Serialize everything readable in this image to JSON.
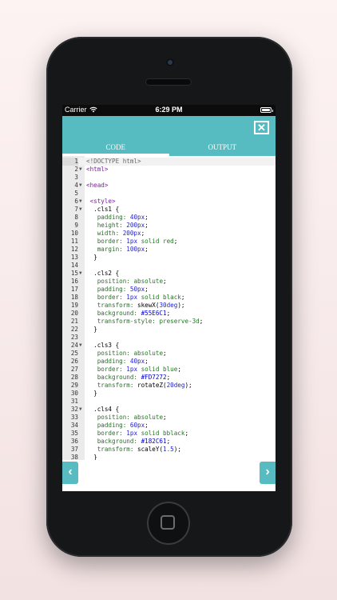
{
  "status_bar": {
    "carrier": "Carrier",
    "time": "6:29 PM"
  },
  "header": {
    "close_label": "✕"
  },
  "tabs": [
    {
      "label": "CODE"
    },
    {
      "label": "OUTPUT"
    }
  ],
  "nav": {
    "prev": "‹",
    "next": "›"
  },
  "colors": {
    "accent": "#56bcc1",
    "phone": "#161719"
  },
  "code_lines": [
    {
      "n": "1",
      "fold": "",
      "tokens": [
        [
          "doctype",
          "<!DOCTYPE html>"
        ]
      ]
    },
    {
      "n": "2",
      "fold": "▼",
      "tokens": [
        [
          "tag",
          "<html>"
        ]
      ]
    },
    {
      "n": "3",
      "fold": "",
      "tokens": []
    },
    {
      "n": "4",
      "fold": "▼",
      "tokens": [
        [
          "tag",
          "<head>"
        ]
      ]
    },
    {
      "n": "5",
      "fold": "",
      "tokens": []
    },
    {
      "n": "6",
      "fold": "▼",
      "tokens": [
        [
          "plain",
          " "
        ],
        [
          "tag",
          "<style>"
        ]
      ]
    },
    {
      "n": "7",
      "fold": "▼",
      "tokens": [
        [
          "plain",
          "  .cls1 {"
        ]
      ]
    },
    {
      "n": "8",
      "fold": "",
      "tokens": [
        [
          "prop",
          "   padding: "
        ],
        [
          "num",
          "40px"
        ],
        [
          "plain",
          ";"
        ]
      ]
    },
    {
      "n": "9",
      "fold": "",
      "tokens": [
        [
          "prop",
          "   height: "
        ],
        [
          "num",
          "200px"
        ],
        [
          "plain",
          ";"
        ]
      ]
    },
    {
      "n": "10",
      "fold": "",
      "tokens": [
        [
          "prop",
          "   width: "
        ],
        [
          "num",
          "200px"
        ],
        [
          "plain",
          ";"
        ]
      ]
    },
    {
      "n": "11",
      "fold": "",
      "tokens": [
        [
          "prop",
          "   border: "
        ],
        [
          "num",
          "1px"
        ],
        [
          "kw",
          " solid red"
        ],
        [
          "plain",
          ";"
        ]
      ]
    },
    {
      "n": "12",
      "fold": "",
      "tokens": [
        [
          "prop",
          "   margin: "
        ],
        [
          "num",
          "100px"
        ],
        [
          "plain",
          ";"
        ]
      ]
    },
    {
      "n": "13",
      "fold": "",
      "tokens": [
        [
          "plain",
          "  }"
        ]
      ]
    },
    {
      "n": "14",
      "fold": "",
      "tokens": []
    },
    {
      "n": "15",
      "fold": "▼",
      "tokens": [
        [
          "plain",
          "  .cls2 {"
        ]
      ]
    },
    {
      "n": "16",
      "fold": "",
      "tokens": [
        [
          "prop",
          "   position: "
        ],
        [
          "kw",
          "absolute"
        ],
        [
          "plain",
          ";"
        ]
      ]
    },
    {
      "n": "17",
      "fold": "",
      "tokens": [
        [
          "prop",
          "   padding: "
        ],
        [
          "num",
          "50px"
        ],
        [
          "plain",
          ";"
        ]
      ]
    },
    {
      "n": "18",
      "fold": "",
      "tokens": [
        [
          "prop",
          "   border: "
        ],
        [
          "num",
          "1px"
        ],
        [
          "kw",
          " solid black"
        ],
        [
          "plain",
          ";"
        ]
      ]
    },
    {
      "n": "19",
      "fold": "",
      "tokens": [
        [
          "prop",
          "   transform: "
        ],
        [
          "fn",
          "skewX("
        ],
        [
          "num",
          "30deg"
        ],
        [
          "fn",
          ")"
        ],
        [
          "plain",
          ";"
        ]
      ]
    },
    {
      "n": "20",
      "fold": "",
      "tokens": [
        [
          "prop",
          "   background: "
        ],
        [
          "color",
          "#55E6C1"
        ],
        [
          "plain",
          ";"
        ]
      ]
    },
    {
      "n": "21",
      "fold": "",
      "tokens": [
        [
          "prop",
          "   transform-style: "
        ],
        [
          "kw",
          "preserve-3d"
        ],
        [
          "plain",
          ";"
        ]
      ]
    },
    {
      "n": "22",
      "fold": "",
      "tokens": [
        [
          "plain",
          "  }"
        ]
      ]
    },
    {
      "n": "23",
      "fold": "",
      "tokens": []
    },
    {
      "n": "24",
      "fold": "▼",
      "tokens": [
        [
          "plain",
          "  .cls3 {"
        ]
      ]
    },
    {
      "n": "25",
      "fold": "",
      "tokens": [
        [
          "prop",
          "   position: "
        ],
        [
          "kw",
          "absolute"
        ],
        [
          "plain",
          ";"
        ]
      ]
    },
    {
      "n": "26",
      "fold": "",
      "tokens": [
        [
          "prop",
          "   padding: "
        ],
        [
          "num",
          "40px"
        ],
        [
          "plain",
          ";"
        ]
      ]
    },
    {
      "n": "27",
      "fold": "",
      "tokens": [
        [
          "prop",
          "   border: "
        ],
        [
          "num",
          "1px"
        ],
        [
          "kw",
          " solid blue"
        ],
        [
          "plain",
          ";"
        ]
      ]
    },
    {
      "n": "28",
      "fold": "",
      "tokens": [
        [
          "prop",
          "   background: "
        ],
        [
          "color",
          "#FD7272"
        ],
        [
          "plain",
          ";"
        ]
      ]
    },
    {
      "n": "29",
      "fold": "",
      "tokens": [
        [
          "prop",
          "   transform: "
        ],
        [
          "fn",
          "rotateZ("
        ],
        [
          "num",
          "20deg"
        ],
        [
          "fn",
          ")"
        ],
        [
          "plain",
          ";"
        ]
      ]
    },
    {
      "n": "30",
      "fold": "",
      "tokens": [
        [
          "plain",
          "  }"
        ]
      ]
    },
    {
      "n": "31",
      "fold": "",
      "tokens": []
    },
    {
      "n": "32",
      "fold": "▼",
      "tokens": [
        [
          "plain",
          "  .cls4 {"
        ]
      ]
    },
    {
      "n": "33",
      "fold": "",
      "tokens": [
        [
          "prop",
          "   position: "
        ],
        [
          "kw",
          "absolute"
        ],
        [
          "plain",
          ";"
        ]
      ]
    },
    {
      "n": "34",
      "fold": "",
      "tokens": [
        [
          "prop",
          "   padding: "
        ],
        [
          "num",
          "60px"
        ],
        [
          "plain",
          ";"
        ]
      ]
    },
    {
      "n": "35",
      "fold": "",
      "tokens": [
        [
          "prop",
          "   border: "
        ],
        [
          "num",
          "1px"
        ],
        [
          "kw",
          " solid bblack"
        ],
        [
          "plain",
          ";"
        ]
      ]
    },
    {
      "n": "36",
      "fold": "",
      "tokens": [
        [
          "prop",
          "   background: "
        ],
        [
          "color",
          "#182C61"
        ],
        [
          "plain",
          ";"
        ]
      ]
    },
    {
      "n": "37",
      "fold": "",
      "tokens": [
        [
          "prop",
          "   transform: "
        ],
        [
          "fn",
          "scaleY("
        ],
        [
          "num",
          "1.5"
        ],
        [
          "fn",
          ")"
        ],
        [
          "plain",
          ";"
        ]
      ]
    },
    {
      "n": "38",
      "fold": "",
      "tokens": [
        [
          "plain",
          "  }"
        ]
      ]
    }
  ]
}
